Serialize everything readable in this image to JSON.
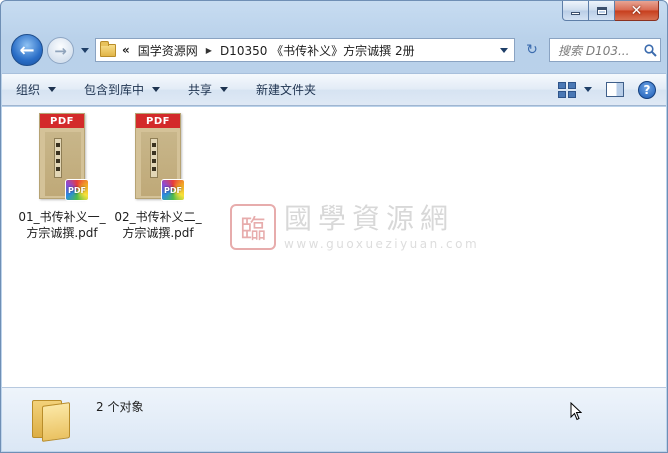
{
  "window": {
    "close_glyph": "✕"
  },
  "nav": {
    "back_glyph": "←",
    "forward_glyph": "→",
    "address": {
      "chevron": "«",
      "segments": [
        "国学资源网",
        "D10350 《书传补义》方宗诚撰 2册"
      ],
      "separator": "▶"
    },
    "refresh_glyph": "↻",
    "search_placeholder": "搜索 D103..."
  },
  "toolbar": {
    "organize": "组织",
    "include_library": "包含到库中",
    "share": "共享",
    "new_folder": "新建文件夹",
    "help": "?"
  },
  "files": [
    {
      "name": "01_书传补义一_方宗诚撰.pdf",
      "header": "PDF",
      "badge": "PDF"
    },
    {
      "name": "02_书传补义二_方宗诚撰.pdf",
      "header": "PDF",
      "badge": "PDF"
    }
  ],
  "watermark": {
    "seal": "臨",
    "chinese": "國學資源網",
    "url": "www.guoxueziyuan.com"
  },
  "details": {
    "object_count": "2 个对象"
  },
  "colors": {
    "pdf_red": "#d32a2a",
    "selection_blue": "#3c6cae"
  }
}
